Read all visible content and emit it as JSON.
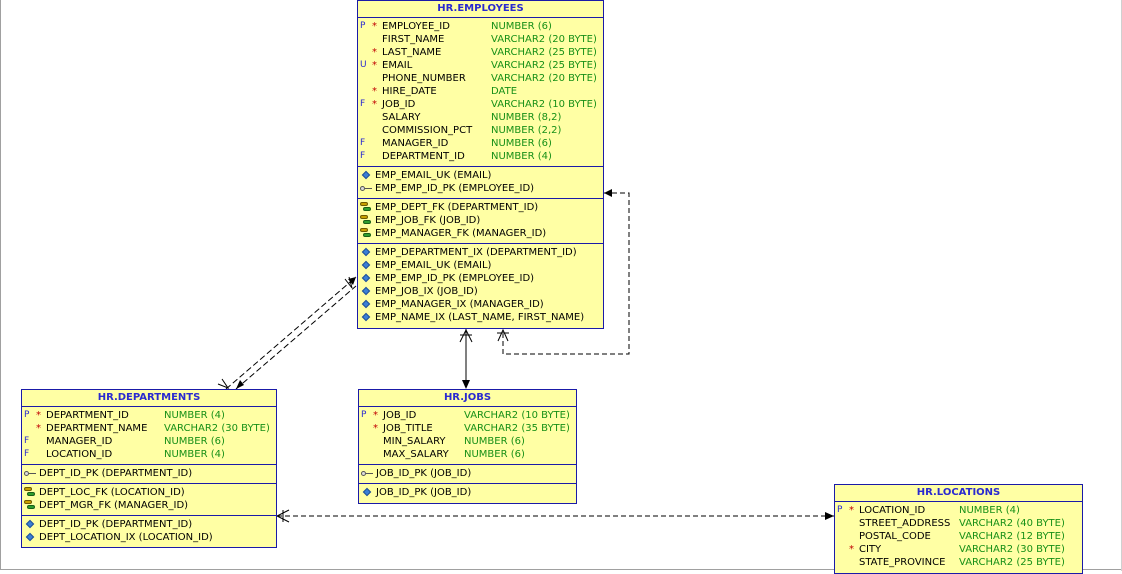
{
  "employees": {
    "title": "HR.EMPLOYEES",
    "columns": [
      {
        "key": "P",
        "mandatory": "*",
        "name": "EMPLOYEE_ID",
        "type": "NUMBER (6)"
      },
      {
        "key": "",
        "mandatory": "",
        "name": "FIRST_NAME",
        "type": "VARCHAR2 (20 BYTE)"
      },
      {
        "key": "",
        "mandatory": "*",
        "name": "LAST_NAME",
        "type": "VARCHAR2 (25 BYTE)"
      },
      {
        "key": "U",
        "mandatory": "*",
        "name": "EMAIL",
        "type": "VARCHAR2 (25 BYTE)"
      },
      {
        "key": "",
        "mandatory": "",
        "name": "PHONE_NUMBER",
        "type": "VARCHAR2 (20 BYTE)"
      },
      {
        "key": "",
        "mandatory": "*",
        "name": "HIRE_DATE",
        "type": "DATE"
      },
      {
        "key": "F",
        "mandatory": "*",
        "name": "JOB_ID",
        "type": "VARCHAR2 (10 BYTE)"
      },
      {
        "key": "",
        "mandatory": "",
        "name": "SALARY",
        "type": "NUMBER (8,2)"
      },
      {
        "key": "",
        "mandatory": "",
        "name": "COMMISSION_PCT",
        "type": "NUMBER (2,2)"
      },
      {
        "key": "F",
        "mandatory": "",
        "name": "MANAGER_ID",
        "type": "NUMBER (6)"
      },
      {
        "key": "F",
        "mandatory": "",
        "name": "DEPARTMENT_ID",
        "type": "NUMBER (4)"
      }
    ],
    "unique_keys": [
      {
        "icon": "unique-key-icon",
        "text": "EMP_EMAIL_UK (EMAIL)"
      },
      {
        "icon": "primary-key-icon",
        "text": "EMP_EMP_ID_PK (EMPLOYEE_ID)"
      }
    ],
    "foreign_keys": [
      {
        "icon": "foreign-key-icon",
        "text": "EMP_DEPT_FK (DEPARTMENT_ID)"
      },
      {
        "icon": "foreign-key-icon",
        "text": "EMP_JOB_FK (JOB_ID)"
      },
      {
        "icon": "foreign-key-icon",
        "text": "EMP_MANAGER_FK (MANAGER_ID)"
      }
    ],
    "indexes": [
      {
        "icon": "index-icon",
        "text": "EMP_DEPARTMENT_IX (DEPARTMENT_ID)"
      },
      {
        "icon": "index-icon",
        "text": "EMP_EMAIL_UK (EMAIL)"
      },
      {
        "icon": "index-icon",
        "text": "EMP_EMP_ID_PK (EMPLOYEE_ID)"
      },
      {
        "icon": "index-icon",
        "text": "EMP_JOB_IX (JOB_ID)"
      },
      {
        "icon": "index-icon",
        "text": "EMP_MANAGER_IX (MANAGER_ID)"
      },
      {
        "icon": "index-icon",
        "text": "EMP_NAME_IX (LAST_NAME, FIRST_NAME)"
      }
    ]
  },
  "departments": {
    "title": "HR.DEPARTMENTS",
    "columns": [
      {
        "key": "P",
        "mandatory": "*",
        "name": "DEPARTMENT_ID",
        "type": "NUMBER (4)"
      },
      {
        "key": "",
        "mandatory": "*",
        "name": "DEPARTMENT_NAME",
        "type": "VARCHAR2 (30 BYTE)"
      },
      {
        "key": "F",
        "mandatory": "",
        "name": "MANAGER_ID",
        "type": "NUMBER (6)"
      },
      {
        "key": "F",
        "mandatory": "",
        "name": "LOCATION_ID",
        "type": "NUMBER (4)"
      }
    ],
    "unique_keys": [
      {
        "icon": "primary-key-icon",
        "text": "DEPT_ID_PK (DEPARTMENT_ID)"
      }
    ],
    "foreign_keys": [
      {
        "icon": "foreign-key-icon",
        "text": "DEPT_LOC_FK (LOCATION_ID)"
      },
      {
        "icon": "foreign-key-icon",
        "text": "DEPT_MGR_FK (MANAGER_ID)"
      }
    ],
    "indexes": [
      {
        "icon": "index-icon",
        "text": "DEPT_ID_PK (DEPARTMENT_ID)"
      },
      {
        "icon": "index-icon",
        "text": "DEPT_LOCATION_IX (LOCATION_ID)"
      }
    ]
  },
  "jobs": {
    "title": "HR.JOBS",
    "columns": [
      {
        "key": "P",
        "mandatory": "*",
        "name": "JOB_ID",
        "type": "VARCHAR2 (10 BYTE)"
      },
      {
        "key": "",
        "mandatory": "*",
        "name": "JOB_TITLE",
        "type": "VARCHAR2 (35 BYTE)"
      },
      {
        "key": "",
        "mandatory": "",
        "name": "MIN_SALARY",
        "type": "NUMBER (6)"
      },
      {
        "key": "",
        "mandatory": "",
        "name": "MAX_SALARY",
        "type": "NUMBER (6)"
      }
    ],
    "unique_keys": [
      {
        "icon": "primary-key-icon",
        "text": "JOB_ID_PK (JOB_ID)"
      }
    ],
    "indexes": [
      {
        "icon": "index-icon",
        "text": "JOB_ID_PK (JOB_ID)"
      }
    ]
  },
  "locations": {
    "title": "HR.LOCATIONS",
    "columns": [
      {
        "key": "P",
        "mandatory": "*",
        "name": "LOCATION_ID",
        "type": "NUMBER (4)"
      },
      {
        "key": "",
        "mandatory": "",
        "name": "STREET_ADDRESS",
        "type": "VARCHAR2 (40 BYTE)"
      },
      {
        "key": "",
        "mandatory": "",
        "name": "POSTAL_CODE",
        "type": "VARCHAR2 (12 BYTE)"
      },
      {
        "key": "",
        "mandatory": "*",
        "name": "CITY",
        "type": "VARCHAR2 (30 BYTE)"
      },
      {
        "key": "",
        "mandatory": "",
        "name": "STATE_PROVINCE",
        "type": "VARCHAR2 (25 BYTE)"
      }
    ]
  }
}
